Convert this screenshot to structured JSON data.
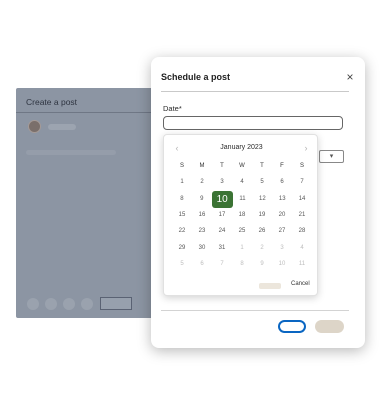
{
  "background_window": {
    "title": "Create a post",
    "toolbar_items": [
      "tool-1",
      "tool-2",
      "tool-3",
      "tool-4"
    ]
  },
  "modal": {
    "title": "Schedule a post",
    "close_icon": "×",
    "date_label": "Date*",
    "date_value": "",
    "time_select_icon": "▾"
  },
  "calendar": {
    "month": "January 2023",
    "prev_icon": "‹",
    "next_icon": "›",
    "weekdays": [
      "S",
      "M",
      "T",
      "W",
      "T",
      "F",
      "S"
    ],
    "weeks": [
      [
        "1",
        "2",
        "3",
        "4",
        "5",
        "6",
        "7"
      ],
      [
        "8",
        "9",
        "10",
        "11",
        "12",
        "13",
        "14"
      ],
      [
        "15",
        "16",
        "17",
        "18",
        "19",
        "20",
        "21"
      ],
      [
        "22",
        "23",
        "24",
        "25",
        "26",
        "27",
        "28"
      ],
      [
        "29",
        "30",
        "31",
        "1",
        "2",
        "3",
        "4"
      ],
      [
        "5",
        "6",
        "7",
        "8",
        "9",
        "10",
        "11"
      ]
    ],
    "selected_day": "10",
    "cancel_label": "Cancel"
  },
  "colors": {
    "selected_day": "#3b7334",
    "primary_outline": "#0a66c2",
    "overlay": "#8c95a3"
  }
}
